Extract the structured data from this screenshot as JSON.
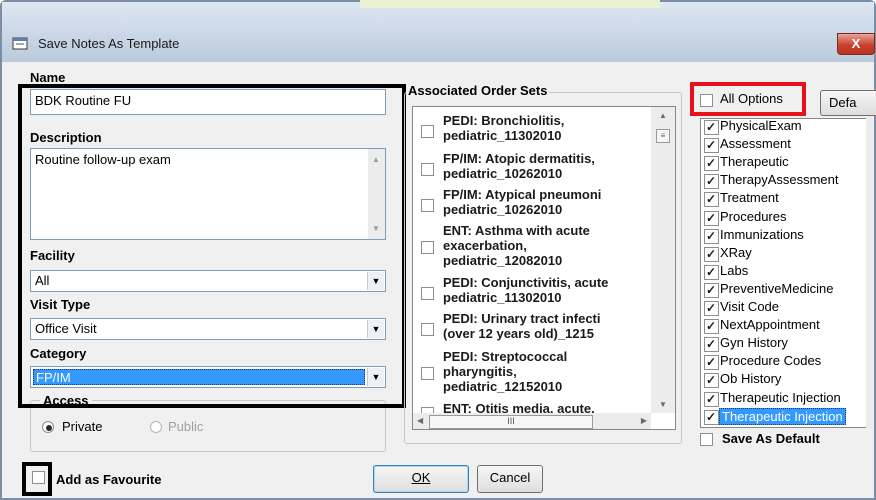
{
  "window": {
    "title": "Save Notes As Template",
    "close_label": "X"
  },
  "form": {
    "name_label": "Name",
    "name_value": "BDK Routine FU",
    "description_label": "Description",
    "description_value": "Routine follow-up exam",
    "facility_label": "Facility",
    "facility_value": "All",
    "visit_type_label": "Visit Type",
    "visit_type_value": "Office Visit",
    "category_label": "Category",
    "category_value": "FP/IM",
    "access_label": "Access",
    "access_private": "Private",
    "access_public": "Public",
    "favourite_label": "Add as Favourite"
  },
  "order_sets": {
    "label": "Associated Order Sets",
    "items": [
      {
        "line1": "PEDI: Bronchiolitis,",
        "line2": "pediatric_11302010"
      },
      {
        "line1": "FP/IM: Atopic dermatitis,",
        "line2": "pediatric_10262010"
      },
      {
        "line1": "FP/IM: Atypical pneumoni",
        "line2": "pediatric_10262010"
      },
      {
        "line1": "ENT: Asthma with acute",
        "line2": "exacerbation,",
        "line3": "pediatric_12082010"
      },
      {
        "line1": "PEDI: Conjunctivitis, acute",
        "line2": "pediatric_11302010"
      },
      {
        "line1": "PEDI: Urinary tract infecti",
        "line2": "(over 12 years old)_1215"
      },
      {
        "line1": "PEDI: Streptococcal",
        "line2": "pharyngitis,",
        "line3": "pediatric_12152010"
      },
      {
        "line1": "ENT: Otitis media, acute,"
      }
    ],
    "hscroll_mark": "III"
  },
  "options": {
    "all_options_label": "All Options",
    "default_button": "Defa",
    "items": [
      "PhysicalExam",
      "Assessment",
      "Therapeutic",
      "TherapyAssessment",
      "Treatment",
      "Procedures",
      "Immunizations",
      "XRay",
      "Labs",
      "PreventiveMedicine",
      "Visit Code",
      "NextAppointment",
      "Gyn History",
      "Procedure Codes",
      "Ob History",
      "Therapeutic Injection",
      "Therapeutic Injection"
    ],
    "save_default_label": "Save As Default"
  },
  "buttons": {
    "ok": "OK",
    "cancel": "Cancel"
  },
  "colors": {
    "selection": "#3399ff",
    "highlight_black": "#000000",
    "highlight_red": "#e8121d"
  }
}
